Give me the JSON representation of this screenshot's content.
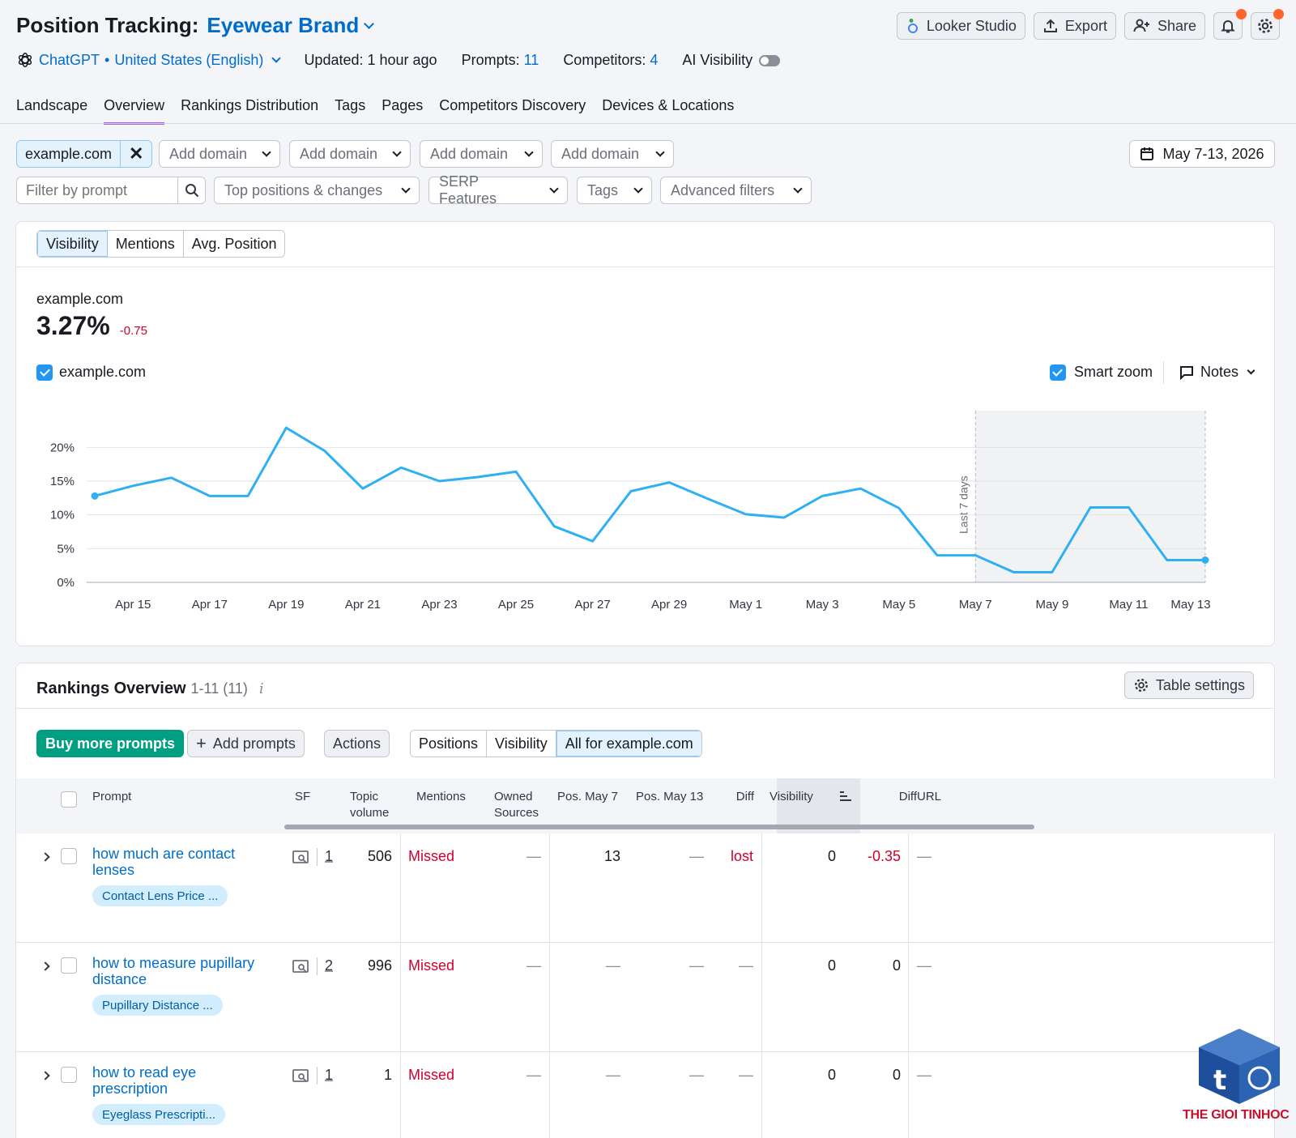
{
  "header": {
    "title_prefix": "Position Tracking:",
    "project": "Eyewear Brand",
    "engine": "ChatGPT",
    "location": "United States (English)",
    "updated": "Updated: 1 hour ago",
    "prompts_label": "Prompts:",
    "prompts_count": "11",
    "competitors_label": "Competitors:",
    "competitors_count": "4",
    "ai_visibility": "AI Visibility",
    "buttons": {
      "looker": "Looker Studio",
      "export": "Export",
      "share": "Share"
    }
  },
  "tabs": [
    "Landscape",
    "Overview",
    "Rankings Distribution",
    "Tags",
    "Pages",
    "Competitors Discovery",
    "Devices & Locations"
  ],
  "filters": {
    "domain": "example.com",
    "add_domain": "Add domain",
    "date_range": "May 7-13, 2026",
    "filter_placeholder": "Filter by prompt",
    "dropdowns": [
      "Top positions & changes",
      "SERP Features",
      "Tags",
      "Advanced filters"
    ]
  },
  "chart_panel": {
    "metric_tabs": [
      "Visibility",
      "Mentions",
      "Avg. Position"
    ],
    "domain": "example.com",
    "value": "3.27%",
    "change": "-0.75",
    "legend": "example.com",
    "smart_zoom": "Smart zoom",
    "notes": "Notes",
    "last7": "Last 7 days"
  },
  "chart_data": {
    "type": "line",
    "x": [
      "Apr 14",
      "Apr 15",
      "Apr 16",
      "Apr 17",
      "Apr 18",
      "Apr 19",
      "Apr 20",
      "Apr 21",
      "Apr 22",
      "Apr 23",
      "Apr 24",
      "Apr 25",
      "Apr 26",
      "Apr 27",
      "Apr 28",
      "Apr 29",
      "Apr 30",
      "May 1",
      "May 2",
      "May 3",
      "May 4",
      "May 5",
      "May 6",
      "May 7",
      "May 8",
      "May 9",
      "May 10",
      "May 11",
      "May 12",
      "May 13"
    ],
    "series": [
      {
        "name": "example.com",
        "values": [
          12.8,
          14.3,
          15.5,
          12.8,
          12.8,
          22.9,
          19.5,
          13.9,
          17.0,
          15.0,
          15.6,
          16.4,
          8.3,
          6.1,
          13.5,
          14.8,
          12.4,
          10.1,
          9.6,
          12.8,
          13.9,
          11.0,
          4.0,
          4.0,
          1.5,
          1.5,
          11.1,
          11.1,
          3.3,
          3.3
        ]
      }
    ],
    "x_ticks": [
      "Apr 15",
      "Apr 17",
      "Apr 19",
      "Apr 21",
      "Apr 23",
      "Apr 25",
      "Apr 27",
      "Apr 29",
      "May 1",
      "May 3",
      "May 5",
      "May 7",
      "May 9",
      "May 11",
      "May 13"
    ],
    "y_ticks": [
      "0%",
      "5%",
      "10%",
      "15%",
      "20%"
    ],
    "ylim": [
      0,
      24
    ],
    "highlight_range": [
      "May 7",
      "May 13"
    ],
    "grid": true,
    "color": "#2eb0f3"
  },
  "rankings": {
    "title": "Rankings Overview",
    "range": "1-11 (11)",
    "info": "i",
    "table_settings": "Table settings",
    "buy": "Buy more prompts",
    "add": "Add prompts",
    "actions": "Actions",
    "view_tabs": [
      "Positions",
      "Visibility",
      "All for example.com"
    ],
    "columns": [
      "Prompt",
      "SF",
      "Topic volume",
      "Mentions",
      "Owned Sources",
      "Pos. May 7",
      "Pos. May 13",
      "Diff",
      "Visibility",
      "Diff",
      "URL"
    ],
    "rows": [
      {
        "prompt": [
          "how much are contact",
          "lenses"
        ],
        "tag": "Contact Lens Price ...",
        "sf": "1",
        "volume": "506",
        "mentions": "Missed",
        "owned": "—",
        "pos1": "13",
        "pos2": "—",
        "diff": "lost",
        "vis": "0",
        "vdiff": "-0.35",
        "url": "—"
      },
      {
        "prompt": [
          "how to measure pupillary",
          "distance"
        ],
        "tag": "Pupillary Distance ...",
        "sf": "2",
        "volume": "996",
        "mentions": "Missed",
        "owned": "—",
        "pos1": "—",
        "pos2": "—",
        "diff": "—",
        "vis": "0",
        "vdiff": "0",
        "url": "—"
      },
      {
        "prompt": [
          "how to read eye",
          "prescription"
        ],
        "tag": "Eyeglass Prescripti...",
        "sf": "1",
        "volume": "1",
        "mentions": "Missed",
        "owned": "—",
        "pos1": "—",
        "pos2": "—",
        "diff": "—",
        "vis": "0",
        "vdiff": "0",
        "url": "—"
      }
    ]
  },
  "watermark": "THE GIOI TINHOC"
}
